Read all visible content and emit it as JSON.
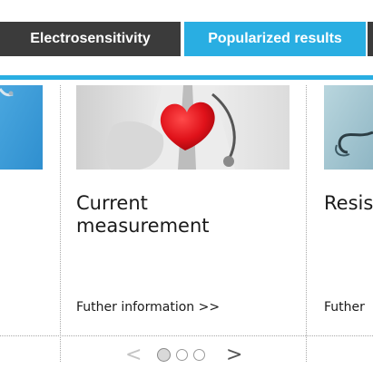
{
  "tabs": [
    {
      "label": "Electrosensitivity",
      "active": false
    },
    {
      "label": "Popularized results",
      "active": true
    }
  ],
  "cards": [
    {
      "title_line1": "",
      "title_line2": "",
      "link": "",
      "image": "stethoscope-on-blue-photo"
    },
    {
      "title_line1": "Current",
      "title_line2": "measurement",
      "link": "Futher information >>",
      "image": "doctor-holding-heart-photo"
    },
    {
      "title_line1": "Resis",
      "title_line2": "",
      "link": "Futher",
      "image": "stethoscope-on-teal-photo"
    }
  ],
  "pager": {
    "prev": "<",
    "next": ">",
    "pages": 3,
    "current": 1
  },
  "colors": {
    "accent": "#29aee2",
    "tab_dark": "#3b3b3b"
  }
}
